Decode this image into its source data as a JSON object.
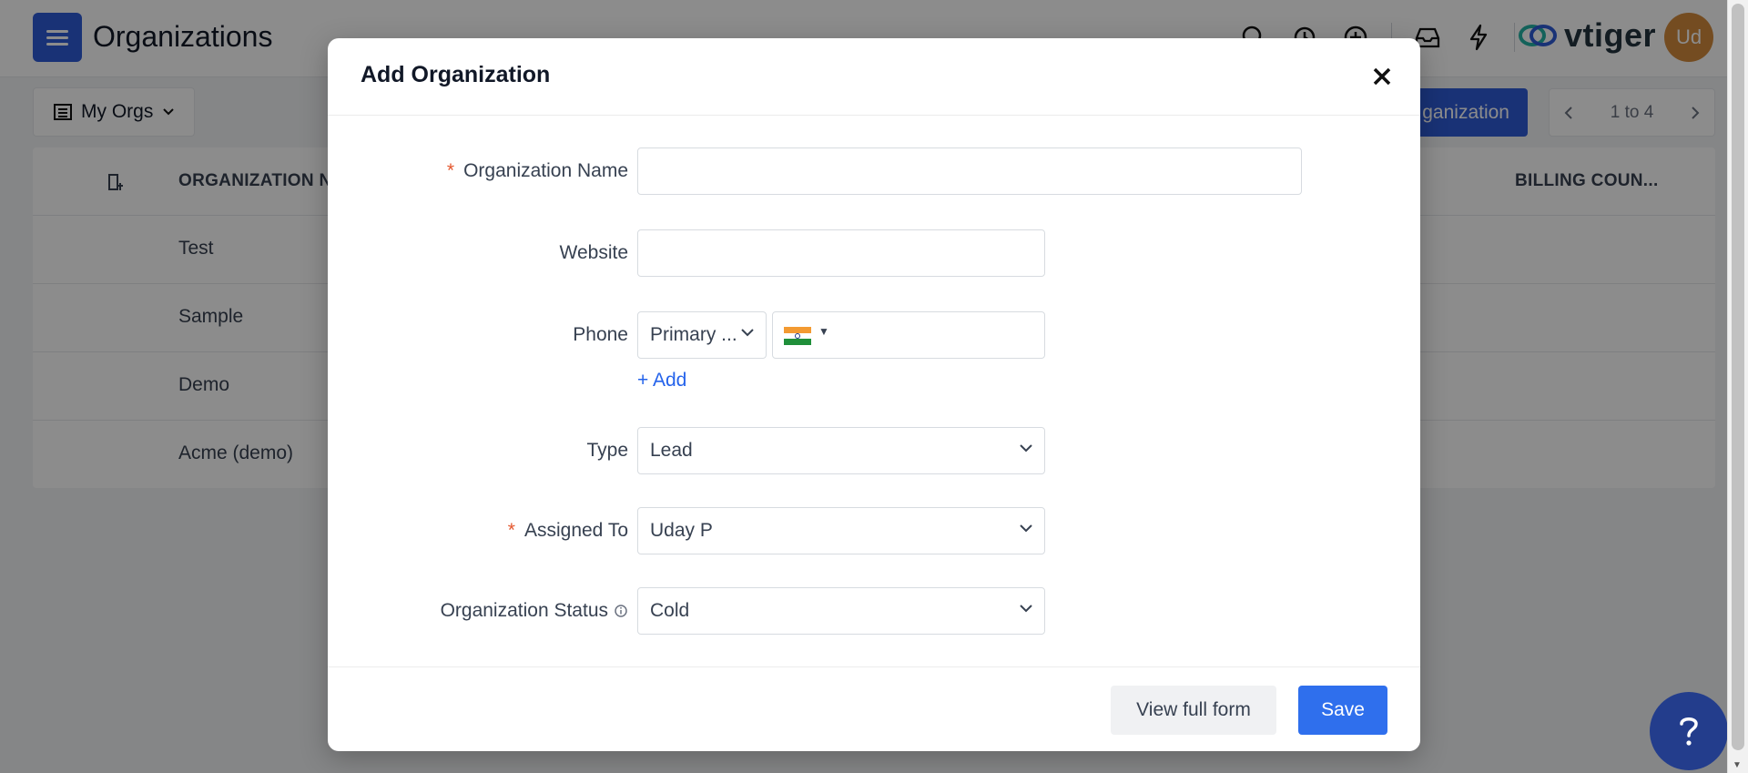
{
  "app": {
    "title": "Organizations",
    "brand": "vtiger",
    "avatar_initials": "Ud",
    "colors": {
      "primary": "#2f5bd8",
      "avatar": "#d48a3c",
      "link": "#2563eb",
      "required": "#e4572e"
    }
  },
  "toolbar": {
    "view_label": "My Orgs",
    "add_button_label": "ganization",
    "pager_text": "1 to 4"
  },
  "table": {
    "headers": [
      "ORGANIZATION N",
      "BILLING COUN..."
    ],
    "rows": [
      "Test",
      "Sample",
      "Demo",
      "Acme (demo)"
    ]
  },
  "modal": {
    "title": "Add Organization",
    "fields": {
      "org_name": {
        "label": "Organization Name",
        "required": "*",
        "value": ""
      },
      "website": {
        "label": "Website",
        "value": ""
      },
      "phone": {
        "label": "Phone",
        "type_value": "Primary ...",
        "country_flag": "india-flag-icon",
        "value": "",
        "add_link": "+ Add"
      },
      "type": {
        "label": "Type",
        "value": "Lead"
      },
      "assigned_to": {
        "label": "Assigned To",
        "required": "*",
        "value": "Uday P"
      },
      "org_status": {
        "label": "Organization Status",
        "value": "Cold"
      }
    },
    "footer": {
      "view_full_form": "View full form",
      "save": "Save"
    }
  }
}
